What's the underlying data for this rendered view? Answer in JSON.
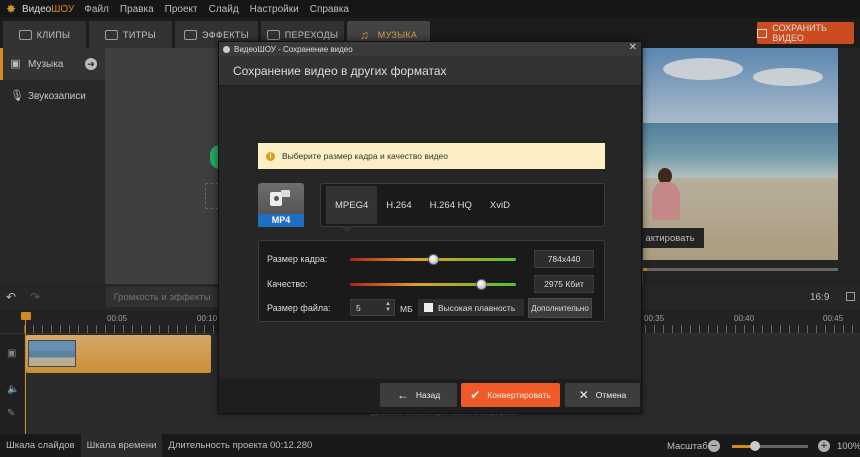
{
  "menubar": {
    "app_name_prefix": "Видео",
    "app_name_suffix": "ШОУ",
    "items": [
      "Файл",
      "Правка",
      "Проект",
      "Слайд",
      "Настройки",
      "Справка"
    ]
  },
  "tabs": [
    {
      "label": "КЛИПЫ"
    },
    {
      "label": "ТИТРЫ"
    },
    {
      "label": "ЭФФЕКТЫ"
    },
    {
      "label": "ПЕРЕХОДЫ"
    },
    {
      "label": "МУЗЫКА"
    }
  ],
  "save_video_label": "СОХРАНИТЬ ВИДЕО",
  "left_panel": {
    "items": [
      {
        "label": "Музыка"
      },
      {
        "label": "Звукозаписи"
      }
    ]
  },
  "preview": {
    "edit_label": "актировать",
    "aspect_ratio": "16:9"
  },
  "toolbar": {
    "volume_effects_label": "Громкость и эффекты"
  },
  "ruler": {
    "labels": [
      "00:05",
      "00:10",
      "00:35",
      "00:40",
      "00:45"
    ]
  },
  "timeline_hint": "удвойного кликните для записи с микрофона",
  "statusbar": {
    "slides_tab": "Шкала слайдов",
    "timeline_tab": "Шкала времени",
    "duration": "Длительность проекта 00:12.280",
    "zoom_label": "Масштаб:",
    "zoom_pct": "100%",
    "zoom_value": 0.3
  },
  "dialog": {
    "window_title": "ВидеоШОУ - Сохранение видео",
    "header": "Сохранение видео в других форматах",
    "info_text": "Выберите размер кадра и качество видео",
    "format_label": "MP4",
    "codecs": [
      "MPEG4",
      "H.264",
      "H.264 HQ",
      "XviD"
    ],
    "selected_codec": "MPEG4",
    "frame_size": {
      "label": "Размер кадра:",
      "value": "784x440",
      "level": 0.5
    },
    "quality": {
      "label": "Качество:",
      "value": "2975 Кбит",
      "level": 0.79
    },
    "file_size": {
      "label": "Размер файла:",
      "value": "5",
      "unit": "МБ"
    },
    "smooth_label": "Высокая плавность",
    "advanced_label": "Дополнительно",
    "back_label": "Назад",
    "convert_label": "Конвертировать",
    "cancel_label": "Отмена",
    "colors": {
      "accent": "#f05a28",
      "format_badge": "#1e6fc4",
      "info_bg": "#fcefc6"
    }
  }
}
